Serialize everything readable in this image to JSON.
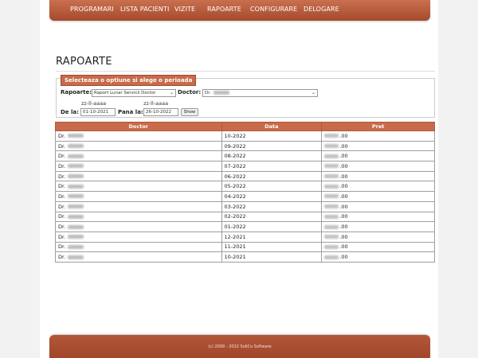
{
  "nav": {
    "items": [
      {
        "label": "PROGRAMARI"
      },
      {
        "label": "LISTA PACIENTI"
      },
      {
        "label": "VIZITE"
      },
      {
        "label": "RAPOARTE"
      },
      {
        "label": "CONFIGURARE"
      },
      {
        "label": "DELOGARE"
      }
    ]
  },
  "page": {
    "title": "RAPOARTE"
  },
  "filter": {
    "legend": "Selecteaza o optiune si alege o perioada",
    "rapoarte_label": "Rapoarte:",
    "rapoarte_value": "Raport Lunar Servicii Doctor",
    "doctor_label": "Doctor:",
    "doctor_value": "Dr.",
    "date_hint_from": "zz-ll-aaaa",
    "date_hint_to": "zz-ll-aaaa",
    "from_label": "De la:",
    "from_value": "01-10-2021",
    "to_label": "Pana la:",
    "to_value": "26-10-2022",
    "show_label": "Show"
  },
  "table": {
    "headers": [
      "Doctor",
      "Data",
      "Pret"
    ],
    "rows": [
      {
        "doctor": "Dr.",
        "data": "10-2022",
        "pret": ".00"
      },
      {
        "doctor": "Dr.",
        "data": "09-2022",
        "pret": ".00"
      },
      {
        "doctor": "Dr.",
        "data": "08-2022",
        "pret": ".00"
      },
      {
        "doctor": "Dr.",
        "data": "07-2022",
        "pret": ".00"
      },
      {
        "doctor": "Dr.",
        "data": "06-2022",
        "pret": ".00"
      },
      {
        "doctor": "Dr.",
        "data": "05-2022",
        "pret": ".00"
      },
      {
        "doctor": "Dr.",
        "data": "04-2022",
        "pret": ".00"
      },
      {
        "doctor": "Dr.",
        "data": "03-2022",
        "pret": ".00"
      },
      {
        "doctor": "Dr.",
        "data": "02-2022",
        "pret": ".00"
      },
      {
        "doctor": "Dr.",
        "data": "01-2022",
        "pret": ".00"
      },
      {
        "doctor": "Dr.",
        "data": "12-2021",
        "pret": ".00"
      },
      {
        "doctor": "Dr.",
        "data": "11-2021",
        "pret": ".00"
      },
      {
        "doctor": "Dr.",
        "data": "10-2021",
        "pret": ".00"
      }
    ]
  },
  "footer": {
    "text": "(c) 2009 - 2022 SoliCo Software"
  }
}
